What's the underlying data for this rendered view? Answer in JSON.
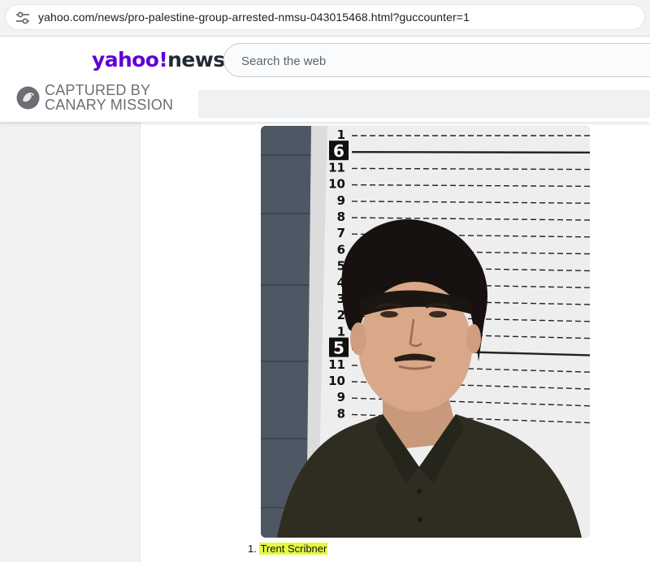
{
  "browser": {
    "url": "yahoo.com/news/pro-palestine-group-arrested-nmsu-043015468.html?guccounter=1",
    "site_info_icon": "tune-icon"
  },
  "header": {
    "logo_part1": "yahoo",
    "logo_bang": "!",
    "logo_part2": "news",
    "search_placeholder": "Search the web",
    "brand_color": "#6001d2"
  },
  "watermark": {
    "line1": "CAPTURED BY",
    "line2": "CANARY MISSION"
  },
  "photo": {
    "ruler_labels": [
      "1",
      "6",
      "11",
      "10",
      "9",
      "8",
      "7",
      "6",
      "5",
      "4",
      "3",
      "2",
      "1",
      "5",
      "11",
      "10",
      "9",
      "8"
    ]
  },
  "caption": {
    "number": "1.",
    "name": "Trent Scribner",
    "highlight_color": "#e5f944"
  }
}
